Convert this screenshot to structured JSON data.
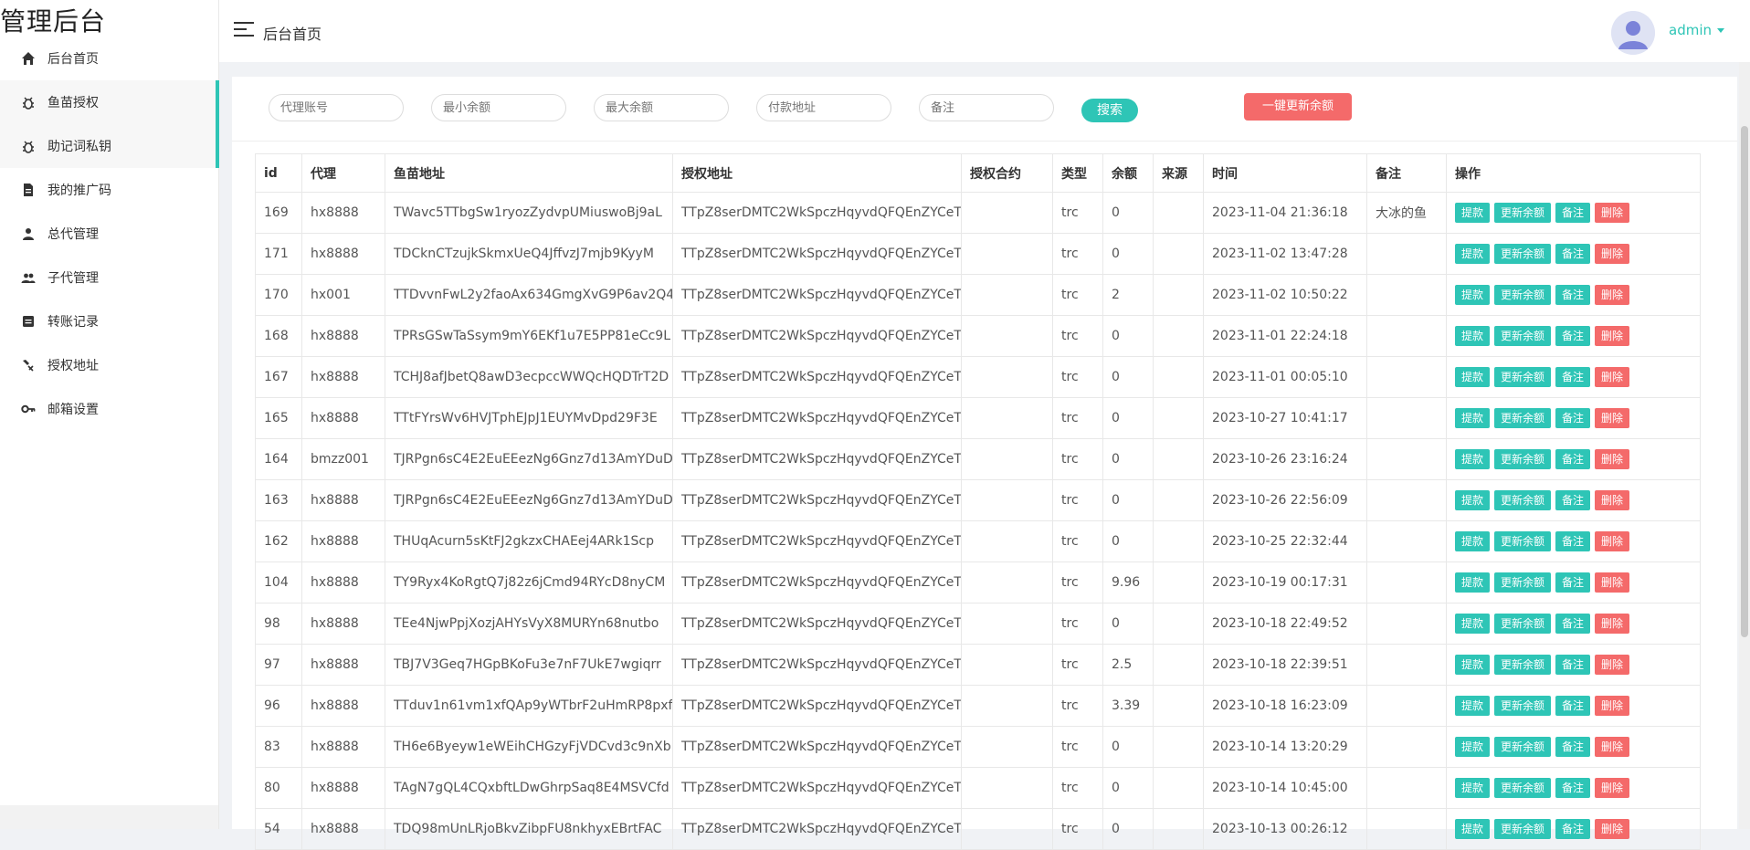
{
  "brand": "管理后台",
  "sidebar": {
    "items": [
      {
        "label": "后台首页",
        "icon": "home-icon"
      },
      {
        "label": "鱼苗授权",
        "icon": "bug-icon"
      },
      {
        "label": "助记词私钥",
        "icon": "bug-icon"
      },
      {
        "label": "我的推广码",
        "icon": "document-icon"
      },
      {
        "label": "总代管理",
        "icon": "person-icon"
      },
      {
        "label": "子代管理",
        "icon": "people-icon"
      },
      {
        "label": "转账记录",
        "icon": "record-icon"
      },
      {
        "label": "授权地址",
        "icon": "tools-icon"
      },
      {
        "label": "邮箱设置",
        "icon": "key-icon"
      }
    ]
  },
  "header": {
    "title": "后台首页",
    "user": "admin"
  },
  "filters": {
    "agent_placeholder": "代理账号",
    "min_balance_placeholder": "最小余额",
    "max_balance_placeholder": "最大余额",
    "pay_address_placeholder": "付款地址",
    "note_placeholder": "备注",
    "search_label": "搜索",
    "update_all_label": "一键更新余额"
  },
  "table": {
    "headers": [
      "id",
      "代理",
      "鱼苗地址",
      "授权地址",
      "授权合约",
      "类型",
      "余额",
      "来源",
      "时间",
      "备注",
      "操作"
    ],
    "actions": {
      "withdraw": "提款",
      "update": "更新余额",
      "note": "备注",
      "delete": "删除"
    },
    "rows": [
      {
        "id": "169",
        "agent": "hx8888",
        "fish": "TWavc5TTbgSw1ryozZydvpUMiuswoBj9aL",
        "auth": "TTpZ8serDMTC2WkSpczHqyvdQFQEnZYCeT",
        "contract": "",
        "type": "trc",
        "balance": "0",
        "source": "",
        "time": "2023-11-04 21:36:18",
        "note": "大冰的鱼"
      },
      {
        "id": "171",
        "agent": "hx8888",
        "fish": "TDCknCTzujkSkmxUeQ4JffvzJ7mjb9KyyM",
        "auth": "TTpZ8serDMTC2WkSpczHqyvdQFQEnZYCeT",
        "contract": "",
        "type": "trc",
        "balance": "0",
        "source": "",
        "time": "2023-11-02 13:47:28",
        "note": ""
      },
      {
        "id": "170",
        "agent": "hx001",
        "fish": "TTDvvnFwL2y2faoAx634GmgXvG9P6av2Q4",
        "auth": "TTpZ8serDMTC2WkSpczHqyvdQFQEnZYCeT",
        "contract": "",
        "type": "trc",
        "balance": "2",
        "source": "",
        "time": "2023-11-02 10:50:22",
        "note": ""
      },
      {
        "id": "168",
        "agent": "hx8888",
        "fish": "TPRsGSwTaSsym9mY6EKf1u7E5PP81eCc9L",
        "auth": "TTpZ8serDMTC2WkSpczHqyvdQFQEnZYCeT",
        "contract": "",
        "type": "trc",
        "balance": "0",
        "source": "",
        "time": "2023-11-01 22:24:18",
        "note": ""
      },
      {
        "id": "167",
        "agent": "hx8888",
        "fish": "TCHJ8afJbetQ8awD3ecpccWWQcHQDTrT2D",
        "auth": "TTpZ8serDMTC2WkSpczHqyvdQFQEnZYCeT",
        "contract": "",
        "type": "trc",
        "balance": "0",
        "source": "",
        "time": "2023-11-01 00:05:10",
        "note": ""
      },
      {
        "id": "165",
        "agent": "hx8888",
        "fish": "TTtFYrsWv6HVJTphEJpJ1EUYMvDpd29F3E",
        "auth": "TTpZ8serDMTC2WkSpczHqyvdQFQEnZYCeT",
        "contract": "",
        "type": "trc",
        "balance": "0",
        "source": "",
        "time": "2023-10-27 10:41:17",
        "note": ""
      },
      {
        "id": "164",
        "agent": "bmzz001",
        "fish": "TJRPgn6sC4E2EuEEezNg6Gnz7d13AmYDuD",
        "auth": "TTpZ8serDMTC2WkSpczHqyvdQFQEnZYCeT",
        "contract": "",
        "type": "trc",
        "balance": "0",
        "source": "",
        "time": "2023-10-26 23:16:24",
        "note": ""
      },
      {
        "id": "163",
        "agent": "hx8888",
        "fish": "TJRPgn6sC4E2EuEEezNg6Gnz7d13AmYDuD",
        "auth": "TTpZ8serDMTC2WkSpczHqyvdQFQEnZYCeT",
        "contract": "",
        "type": "trc",
        "balance": "0",
        "source": "",
        "time": "2023-10-26 22:56:09",
        "note": ""
      },
      {
        "id": "162",
        "agent": "hx8888",
        "fish": "THUqAcurn5sKtFJ2gkzxCHAEej4ARk1Scp",
        "auth": "TTpZ8serDMTC2WkSpczHqyvdQFQEnZYCeT",
        "contract": "",
        "type": "trc",
        "balance": "0",
        "source": "",
        "time": "2023-10-25 22:32:44",
        "note": ""
      },
      {
        "id": "104",
        "agent": "hx8888",
        "fish": "TY9Ryx4KoRgtQ7j82z6jCmd94RYcD8nyCM",
        "auth": "TTpZ8serDMTC2WkSpczHqyvdQFQEnZYCeT",
        "contract": "",
        "type": "trc",
        "balance": "9.96",
        "source": "",
        "time": "2023-10-19 00:17:31",
        "note": ""
      },
      {
        "id": "98",
        "agent": "hx8888",
        "fish": "TEe4NjwPpjXozjAHYsVyX8MURYn68nutbo",
        "auth": "TTpZ8serDMTC2WkSpczHqyvdQFQEnZYCeT",
        "contract": "",
        "type": "trc",
        "balance": "0",
        "source": "",
        "time": "2023-10-18 22:49:52",
        "note": ""
      },
      {
        "id": "97",
        "agent": "hx8888",
        "fish": "TBJ7V3Geq7HGpBKoFu3e7nF7UkE7wgiqrr",
        "auth": "TTpZ8serDMTC2WkSpczHqyvdQFQEnZYCeT",
        "contract": "",
        "type": "trc",
        "balance": "2.5",
        "source": "",
        "time": "2023-10-18 22:39:51",
        "note": ""
      },
      {
        "id": "96",
        "agent": "hx8888",
        "fish": "TTduv1n61vm1xfQAp9yWTbrF2uHmRP8pxf",
        "auth": "TTpZ8serDMTC2WkSpczHqyvdQFQEnZYCeT",
        "contract": "",
        "type": "trc",
        "balance": "3.39",
        "source": "",
        "time": "2023-10-18 16:23:09",
        "note": ""
      },
      {
        "id": "83",
        "agent": "hx8888",
        "fish": "TH6e6Byeyw1eWEihCHGzyFjVDCvd3c9nXb",
        "auth": "TTpZ8serDMTC2WkSpczHqyvdQFQEnZYCeT",
        "contract": "",
        "type": "trc",
        "balance": "0",
        "source": "",
        "time": "2023-10-14 13:20:29",
        "note": ""
      },
      {
        "id": "80",
        "agent": "hx8888",
        "fish": "TAgN7gQL4CQxbftLDwGhrpSaq8E4MSVCfd",
        "auth": "TTpZ8serDMTC2WkSpczHqyvdQFQEnZYCeT",
        "contract": "",
        "type": "trc",
        "balance": "0",
        "source": "",
        "time": "2023-10-14 10:45:00",
        "note": ""
      },
      {
        "id": "54",
        "agent": "hx8888",
        "fish": "TDQ98mUnLRjoBkvZibpFU8nkhyxEBrtFAC",
        "auth": "TTpZ8serDMTC2WkSpczHqyvdQFQEnZYCeT",
        "contract": "",
        "type": "trc",
        "balance": "0",
        "source": "",
        "time": "2023-10-13 00:26:12",
        "note": ""
      }
    ]
  },
  "colors": {
    "accent": "#2ec5b6",
    "danger": "#f46a6a"
  }
}
